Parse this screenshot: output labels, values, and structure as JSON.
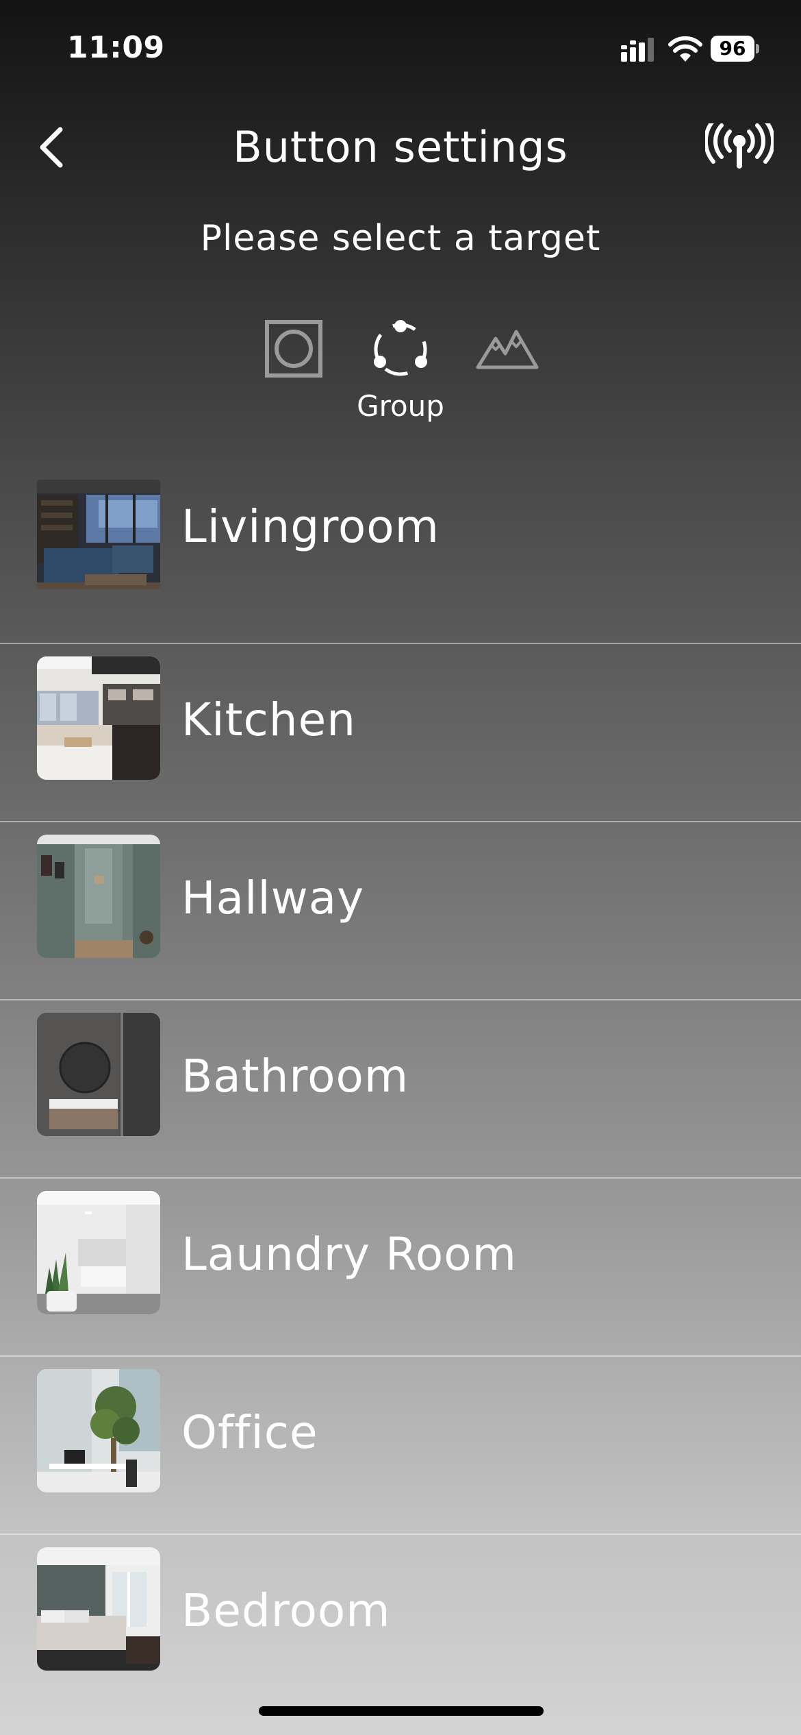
{
  "status_bar": {
    "time": "11:09",
    "battery": "96",
    "icons": [
      "signal-icon",
      "wifi-icon",
      "battery-icon"
    ]
  },
  "header": {
    "title": "Button settings",
    "back_icon": "chevron-left-icon",
    "action_icon": "antenna-broadcast-icon"
  },
  "subtitle": "Please select a target",
  "target_tabs": [
    {
      "icon": "device-icon",
      "label": "",
      "selected": false
    },
    {
      "icon": "group-icon",
      "label": "Group",
      "selected": true
    },
    {
      "icon": "scene-mountain-icon",
      "label": "",
      "selected": false
    }
  ],
  "rooms": [
    {
      "label": "Livingroom",
      "thumbnail": "livingroom-photo"
    },
    {
      "label": "Kitchen",
      "thumbnail": "kitchen-photo"
    },
    {
      "label": "Hallway",
      "thumbnail": "hallway-photo"
    },
    {
      "label": "Bathroom",
      "thumbnail": "bathroom-photo"
    },
    {
      "label": "Laundry Room",
      "thumbnail": "laundry-room-photo"
    },
    {
      "label": "Office",
      "thumbnail": "office-photo"
    },
    {
      "label": "Bedroom",
      "thumbnail": "bedroom-photo"
    }
  ],
  "colors": {
    "text": "#ffffff",
    "inactive_icon": "#9a9a9a",
    "background_top": "#131313",
    "background_bottom": "#d3d3d3"
  }
}
